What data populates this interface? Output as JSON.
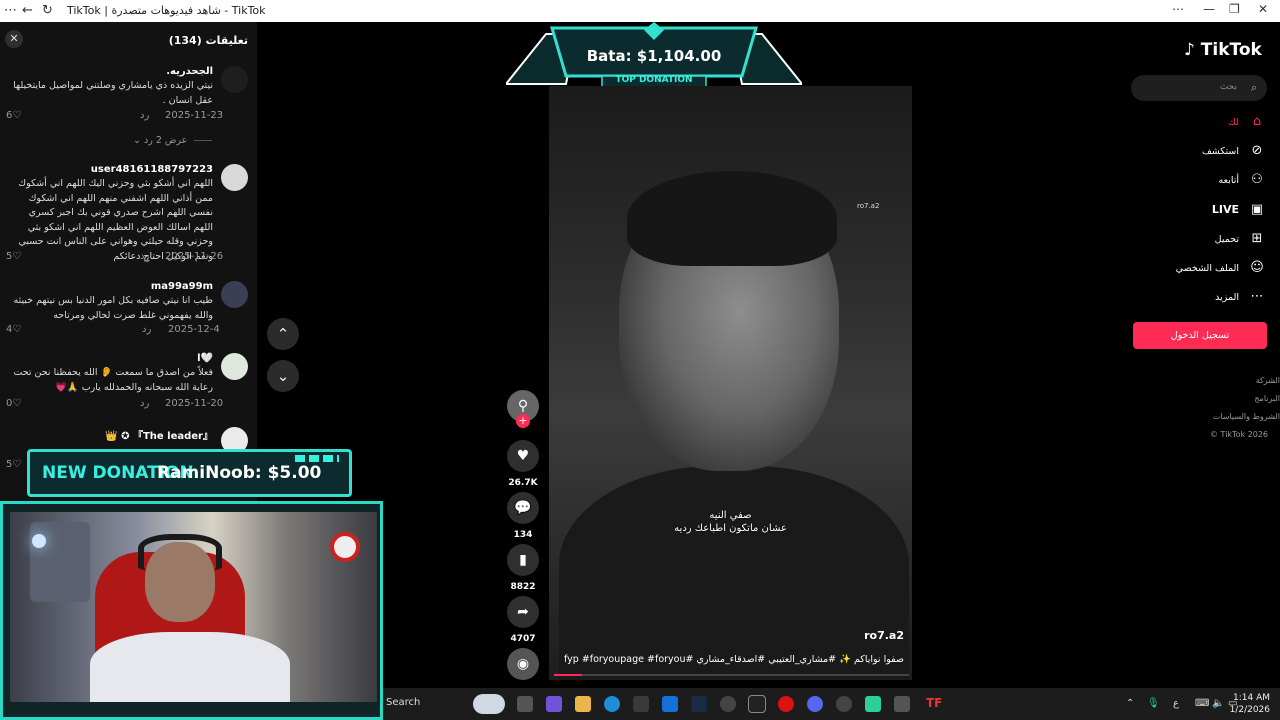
{
  "browser": {
    "title": "TikTok | شاهد فيديوهات متصدرة - TikTok"
  },
  "comments_panel": {
    "title": "تعليقات (134)",
    "close_label": "✕",
    "items": [
      {
        "user": "الجحدريه.",
        "text": "نيتي الزيده ذي يامشاري وصلتني لمواصيل مايتخيلها عقل انسان .",
        "date": "2025-11-23",
        "reply": "رد",
        "likes": "6",
        "avatar_color": "#1e1e1e"
      },
      {
        "user": "user48161188797223",
        "text": "اللهم اني أشكو بثي وحزني اليك اللهم اني أشكوك ممن أذاني اللهم اشفني منهم اللهم اني اشكوك نفسي اللهم اشرح صدري قوني بك اجبر كسري اللهم اسالك العوض العظيم اللهم اني اشكو بثي وحزني وقله حيلتي وهواني على الناس انت حسبي ونعم الوكيل احتاج دعائكم",
        "date": "2025-11-26",
        "reply": "رد",
        "likes": "5",
        "avatar_color": "#d9d9d9"
      },
      {
        "user": "ma99a99m",
        "text": "طيب انا نيتي صافيه بكل امور الدنيا بس نيتهم خبيثه والله يفهموني غلط صرت لحالي ومرتاحه",
        "date": "2025-12-4",
        "reply": "رد",
        "likes": "4",
        "avatar_color": "#3a3f55"
      },
      {
        "user": "🤍ا",
        "text": "فعلاً من اصدق ما سمعت 👂 الله يحفظنا نحن تحت رعاية الله سبحانه والحمدلله يارب 🙏💗",
        "date": "2025-11-20",
        "reply": "رد",
        "likes": "0",
        "avatar_color": "#dfe8dc"
      },
      {
        "user": "『The leader』 ✪ 👑",
        "text": "",
        "date": "",
        "reply": "",
        "likes": "5",
        "avatar_color": "#eaeaea"
      }
    ],
    "view_replies": "عرض 2 رد"
  },
  "video": {
    "watermark": "ro7.a2",
    "subtitle_line1": "صفي النيه",
    "subtitle_line2": "عشان ماتكون اطباعك رديه",
    "author": "ro7.a2",
    "caption": "صفوا نواياكم ✨ #مشاري_العتيبي #اصدقاء_مشاري #fyp #foryoupage #foryou",
    "progress_fraction": 0.08
  },
  "actions": {
    "likes": "26.7K",
    "comments": "134",
    "saves": "8822",
    "shares": "4707"
  },
  "overlays": {
    "top_donation_amount": "Bata: $1,104.00",
    "top_donation_label": "TOP DONATION",
    "new_donation_label": "NEW DONATION",
    "new_donation_name": "RamiNoob: $5.00"
  },
  "sidebar": {
    "logo": "TikTok",
    "search_placeholder": "بحث",
    "items": [
      {
        "label": "لك",
        "icon": "home-icon"
      },
      {
        "label": "استكشف",
        "icon": "compass-icon"
      },
      {
        "label": "أتابعه",
        "icon": "following-icon"
      },
      {
        "label": "LIVE",
        "icon": "live-icon"
      },
      {
        "label": "تحميل",
        "icon": "upload-icon"
      },
      {
        "label": "الملف الشخصي",
        "icon": "profile-icon"
      },
      {
        "label": "المزيد",
        "icon": "more-icon"
      }
    ],
    "login_button": "تسجيل الدخول",
    "footer": [
      "الشركة",
      "البرنامج",
      "الشروط والسياسات",
      "TikTok 2026 ©"
    ]
  },
  "taskbar": {
    "search": "Search",
    "time": "1:14 AM",
    "date": "1/2/2026",
    "lang": "ع"
  },
  "colors": {
    "accent": "#fe2c55",
    "overlay_cyan": "#33e0d0"
  }
}
